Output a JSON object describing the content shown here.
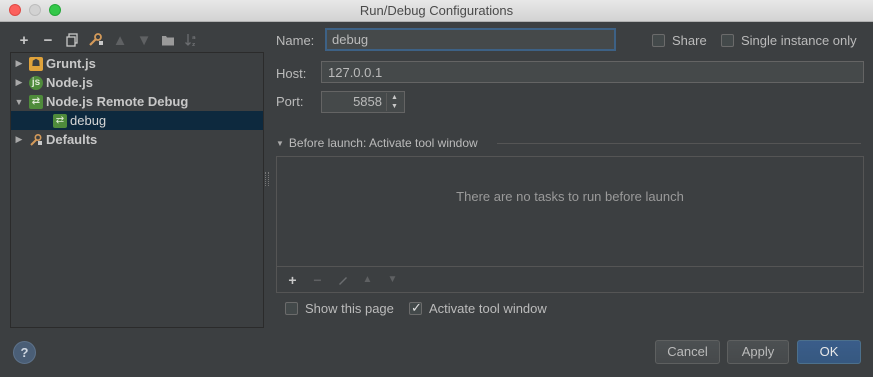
{
  "window": {
    "title": "Run/Debug Configurations"
  },
  "toolbar": {
    "icons": [
      "add-icon",
      "remove-icon",
      "copy-icon",
      "wrench-icon",
      "move-up-icon",
      "move-down-icon",
      "folder-icon",
      "sort-icon"
    ]
  },
  "tree": {
    "items": [
      {
        "label": "Grunt.js",
        "icon": "grunt-icon",
        "expanded": false
      },
      {
        "label": "Node.js",
        "icon": "nodejs-icon",
        "expanded": false
      },
      {
        "label": "Node.js Remote Debug",
        "icon": "remote-debug-icon",
        "expanded": true
      },
      {
        "label": "debug",
        "icon": "remote-debug-icon",
        "selected": true
      },
      {
        "label": "Defaults",
        "icon": "defaults-icon",
        "expanded": false
      }
    ]
  },
  "form": {
    "name_label": "Name:",
    "name_value": "debug",
    "share_label": "Share",
    "single_instance_label": "Single instance only",
    "host_label": "Host:",
    "host_value": "127.0.0.1",
    "port_label": "Port:",
    "port_value": "5858"
  },
  "before_launch": {
    "header": "Before launch: Activate tool window",
    "empty_text": "There are no tasks to run before launch"
  },
  "options": {
    "show_page_label": "Show this page",
    "show_page_checked": false,
    "activate_label": "Activate tool window",
    "activate_checked": true
  },
  "buttons": {
    "cancel": "Cancel",
    "apply": "Apply",
    "ok": "OK",
    "help": "?"
  },
  "colors": {
    "background": "#3c3f41",
    "selection": "#0d293e",
    "ok_button": "#365880",
    "focus_border": "#3d6185"
  }
}
